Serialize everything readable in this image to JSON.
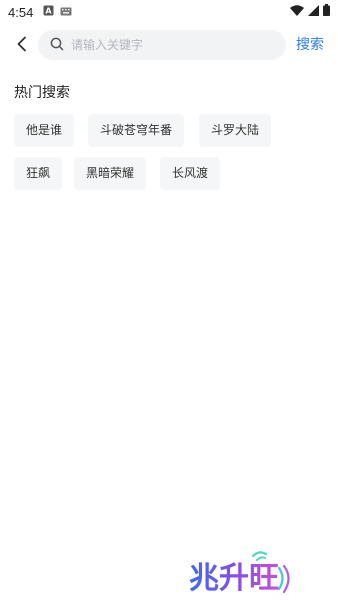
{
  "status_bar": {
    "time": "4:54",
    "left_icons": [
      "a-box-icon",
      "keyboard-icon"
    ],
    "right_icons": [
      "wifi-icon",
      "signal-icon",
      "battery-icon"
    ]
  },
  "search": {
    "back_icon": "chevron-left-icon",
    "search_icon": "search-icon",
    "placeholder": "请输入关键字",
    "value": "",
    "submit_label": "搜索",
    "accent_color": "#2b7de9"
  },
  "hot": {
    "title": "热门搜索",
    "tags": [
      {
        "label": "他是谁"
      },
      {
        "label": "斗破苍穹年番"
      },
      {
        "label": "斗罗大陆"
      },
      {
        "label": "狂飙"
      },
      {
        "label": "黑暗荣耀"
      },
      {
        "label": "长风渡"
      }
    ]
  },
  "watermark": {
    "text": "兆升旺"
  }
}
